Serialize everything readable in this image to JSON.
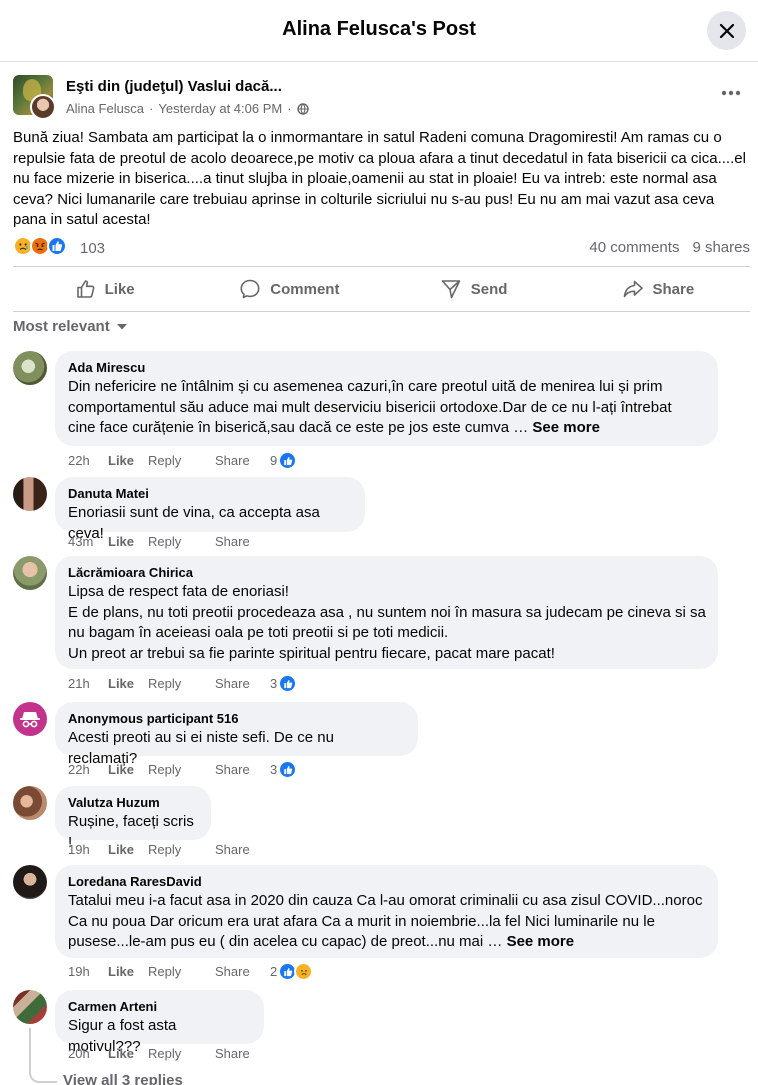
{
  "header": {
    "title": "Alina Felusca's Post",
    "close_icon": "close-icon"
  },
  "post": {
    "group_name": "Eşti din (judeţul) Vaslui dacă...",
    "author": "Alina Felusca",
    "separator": "·",
    "time": "Yesterday at 4:06 PM",
    "separator2": "·",
    "privacy_icon": "globe-icon",
    "body": "Bună ziua! Sambata am participat la o inmormantare in satul Radeni comuna Dragomiresti! Am ramas cu o repulsie  fata de preotul de acolo deoarece,pe motiv ca ploua afara a tinut decedatul in fata bisericii ca cica....el nu face mizerie in biserica....a tinut slujba in ploaie,oamenii au stat in ploaie! Eu va intreb: este normal asa ceva? Nici lumanarile care trebuiau aprinse in colturile sicriului nu s-au pus! Eu nu am mai vazut asa ceva pana in satul acesta!",
    "reactions": [
      "sad",
      "angry",
      "like"
    ],
    "reaction_count": "103",
    "comments_count": "40 comments",
    "shares_count": "9 shares"
  },
  "actions": {
    "like": "Like",
    "comment": "Comment",
    "send": "Send",
    "share": "Share"
  },
  "sort_label": "Most relevant",
  "action_labels": {
    "like": "Like",
    "reply": "Reply",
    "share": "Share"
  },
  "comments": [
    {
      "name": "Ada Mirescu",
      "line1": "Din nefericire ne întâlnim și cu asemenea cazuri,în care preotul uită de menirea lui și prim",
      "line2": "comportamentul său aduce mai mult deserviciu bisericii ortodoxe.Dar de ce nu l-ați întrebat",
      "line3": "cine face curățenie în biserică,sau dacă ce este pe jos este cumva … ",
      "see_more": "See more",
      "time": "22h",
      "reaction_count": "9"
    },
    {
      "name": "Danuta Matei",
      "line1": "Enoriasii sunt de vina, ca accepta asa ceva!",
      "time": "43m"
    },
    {
      "name": "Lăcrămioara Chirica",
      "line1": "Lipsa de respect fata de enoriasi!",
      "line2": "E de plans, nu toti preotii procedeaza asa , nu suntem noi în masura sa judecam pe cineva si sa",
      "line3": "nu bagam în aceieasi oala pe toti preotii si pe toti medicii.",
      "line4": "Un preot ar trebui sa fie parinte spiritual pentru fiecare, pacat mare pacat!",
      "time": "21h",
      "reaction_count": "3"
    },
    {
      "name": "Anonymous participant 516",
      "line1": "Acesti preoti au si ei niste sefi. De ce nu reclamați?",
      "time": "22h",
      "reaction_count": "3"
    },
    {
      "name": "Valutza Huzum",
      "line1": "Rușine, faceți scris !",
      "time": "19h"
    },
    {
      "name": "Loredana RaresDavid",
      "line1": "Tatalui meu i-a facut asa in 2020 din cauza Ca l-au omorat criminalii cu asa zisul COVID...noroc",
      "line2": "Ca nu poua Dar oricum era urat afara Ca a murit in noiembrie...la fel Nici luminarile nu le",
      "line3": "pusese...le-am pus eu ( din acelea cu capac) de preot...nu mai … ",
      "see_more": "See more",
      "time": "19h",
      "reaction_count": "2"
    },
    {
      "name": "Carmen Arteni",
      "line1": "Sigur a fost asta motivul???",
      "time": "20h"
    }
  ],
  "view_replies": "View all 3 replies"
}
